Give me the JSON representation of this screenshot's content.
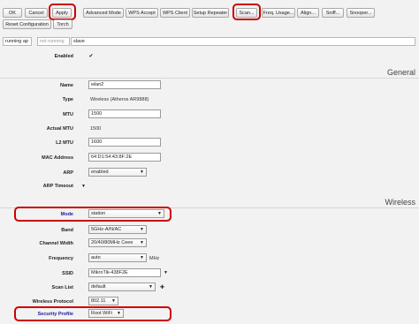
{
  "toolbar": {
    "ok": "OK",
    "cancel": "Cancel",
    "apply": "Apply",
    "advanced_mode": "Advanced Mode",
    "wps_accept": "WPS Accept",
    "wps_client": "WPS Client",
    "setup_repeater": "Setup Repeater",
    "scan": "Scan...",
    "freq_usage": "Freq. Usage...",
    "align": "Align...",
    "sniff": "Sniff...",
    "snooper": "Snooper...",
    "reset_configuration": "Reset Configuration",
    "torch": "Torch"
  },
  "status_bar": {
    "running": "running ap",
    "not_running": "not running",
    "slave": "slave"
  },
  "form": {
    "enabled_label": "Enabled",
    "enabled_checked": true,
    "section_general": "General",
    "name_label": "Name",
    "name_value": "wlan2",
    "type_label": "Type",
    "type_value": "Wireless (Atheros AR9888)",
    "mtu_label": "MTU",
    "mtu_value": "1500",
    "actual_mtu_label": "Actual MTU",
    "actual_mtu_value": "1500",
    "l2mtu_label": "L2 MTU",
    "l2mtu_value": "1600",
    "mac_label": "MAC Address",
    "mac_value": "64:D1:54:43:8F:2E",
    "arp_label": "ARP",
    "arp_value": "enabled",
    "arp_timeout_label": "ARP Timeout",
    "section_wireless": "Wireless",
    "mode_label": "Mode",
    "mode_value": "station",
    "band_label": "Band",
    "band_value": "5GHz-A/N/AC",
    "channel_width_label": "Channel Width",
    "channel_width_value": "20/40/80MHz Ceee",
    "frequency_label": "Frequency",
    "frequency_value": "auto",
    "frequency_unit": "MHz",
    "ssid_label": "SSID",
    "ssid_value": "MikroTik-438F2E",
    "scan_list_label": "Scan List",
    "scan_list_value": "default",
    "wireless_protocol_label": "Wireless Protocol",
    "wireless_protocol_value": "802.11",
    "security_profile_label": "Security Profile",
    "security_profile_value": "Root WiFi"
  },
  "colors": {
    "highlight": "#cc0000",
    "background": "#f2f2f2",
    "mode_label": "#1a1aa0"
  },
  "icons": {
    "checkbox": "check-mark",
    "dropdown": "chevron-down-icon",
    "expand": "triangle-down-icon",
    "add": "plus-icon"
  }
}
